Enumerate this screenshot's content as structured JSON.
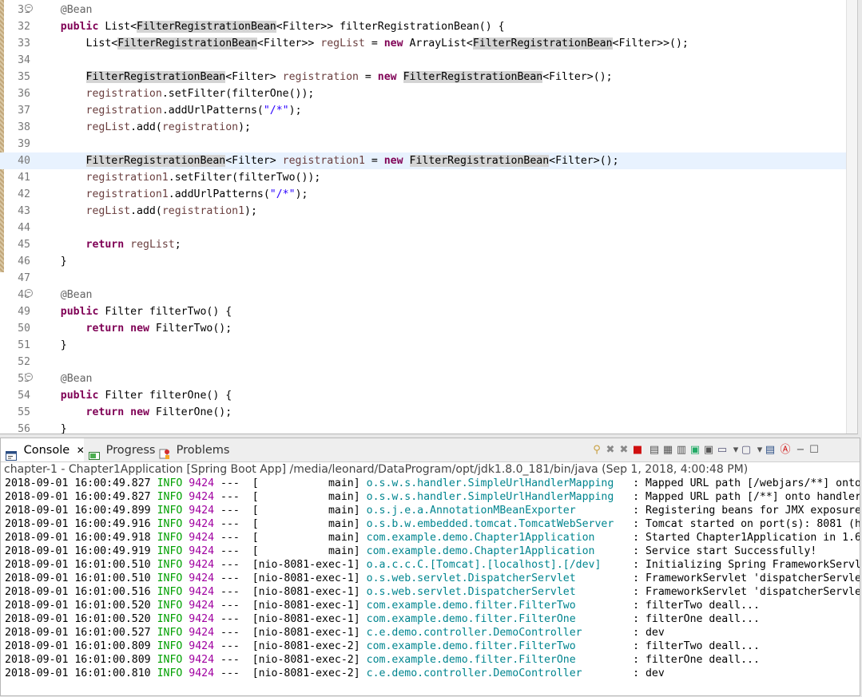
{
  "editor": {
    "lines": [
      {
        "n": "31",
        "fold": true,
        "segs": [
          {
            "t": "    "
          },
          {
            "t": "@Bean",
            "c": "ann"
          }
        ]
      },
      {
        "n": "32",
        "segs": [
          {
            "t": "    "
          },
          {
            "t": "public",
            "c": "kw"
          },
          {
            "t": " List<"
          },
          {
            "t": "FilterRegistrationBean",
            "c": "hl"
          },
          {
            "t": "<Filter>> filterRegistrationBean() {"
          }
        ]
      },
      {
        "n": "33",
        "segs": [
          {
            "t": "        List<"
          },
          {
            "t": "FilterRegistrationBean",
            "c": "hl"
          },
          {
            "t": "<Filter>> "
          },
          {
            "t": "regList",
            "c": "fld"
          },
          {
            "t": " = "
          },
          {
            "t": "new",
            "c": "kw"
          },
          {
            "t": " ArrayList<"
          },
          {
            "t": "FilterRegistrationBean",
            "c": "hl"
          },
          {
            "t": "<Filter>>();"
          }
        ]
      },
      {
        "n": "34",
        "segs": []
      },
      {
        "n": "35",
        "segs": [
          {
            "t": "        "
          },
          {
            "t": "FilterRegistrationBean",
            "c": "hl"
          },
          {
            "t": "<Filter> "
          },
          {
            "t": "registration",
            "c": "fld"
          },
          {
            "t": " = "
          },
          {
            "t": "new",
            "c": "kw"
          },
          {
            "t": " "
          },
          {
            "t": "FilterRegistrationBean",
            "c": "hl"
          },
          {
            "t": "<Filter>();"
          }
        ]
      },
      {
        "n": "36",
        "segs": [
          {
            "t": "        "
          },
          {
            "t": "registration",
            "c": "fld"
          },
          {
            "t": ".setFilter(filterOne());"
          }
        ]
      },
      {
        "n": "37",
        "segs": [
          {
            "t": "        "
          },
          {
            "t": "registration",
            "c": "fld"
          },
          {
            "t": ".addUrlPatterns("
          },
          {
            "t": "\"/*\"",
            "c": "str"
          },
          {
            "t": ");"
          }
        ]
      },
      {
        "n": "38",
        "segs": [
          {
            "t": "        "
          },
          {
            "t": "regList",
            "c": "fld"
          },
          {
            "t": ".add("
          },
          {
            "t": "registration",
            "c": "fld"
          },
          {
            "t": ");"
          }
        ]
      },
      {
        "n": "39",
        "segs": []
      },
      {
        "n": "40",
        "current": true,
        "segs": [
          {
            "t": "        "
          },
          {
            "t": "FilterRegistrationBean",
            "c": "hl"
          },
          {
            "t": "<Filter> "
          },
          {
            "t": "registration1",
            "c": "fld"
          },
          {
            "t": " = "
          },
          {
            "t": "new",
            "c": "kw"
          },
          {
            "t": " "
          },
          {
            "t": "FilterRegistrationBean",
            "c": "hl"
          },
          {
            "t": "<Filter>();"
          }
        ]
      },
      {
        "n": "41",
        "segs": [
          {
            "t": "        "
          },
          {
            "t": "registration1",
            "c": "fld"
          },
          {
            "t": ".setFilter(filterTwo());"
          }
        ]
      },
      {
        "n": "42",
        "segs": [
          {
            "t": "        "
          },
          {
            "t": "registration1",
            "c": "fld"
          },
          {
            "t": ".addUrlPatterns("
          },
          {
            "t": "\"/*\"",
            "c": "str"
          },
          {
            "t": ");"
          }
        ]
      },
      {
        "n": "43",
        "segs": [
          {
            "t": "        "
          },
          {
            "t": "regList",
            "c": "fld"
          },
          {
            "t": ".add("
          },
          {
            "t": "registration1",
            "c": "fld"
          },
          {
            "t": ");"
          }
        ]
      },
      {
        "n": "44",
        "segs": []
      },
      {
        "n": "45",
        "segs": [
          {
            "t": "        "
          },
          {
            "t": "return",
            "c": "kw"
          },
          {
            "t": " "
          },
          {
            "t": "regList",
            "c": "fld"
          },
          {
            "t": ";"
          }
        ]
      },
      {
        "n": "46",
        "segs": [
          {
            "t": "    }"
          }
        ]
      },
      {
        "n": "47",
        "segs": []
      },
      {
        "n": "48",
        "fold": true,
        "segs": [
          {
            "t": "    "
          },
          {
            "t": "@Bean",
            "c": "ann"
          }
        ]
      },
      {
        "n": "49",
        "segs": [
          {
            "t": "    "
          },
          {
            "t": "public",
            "c": "kw"
          },
          {
            "t": " Filter filterTwo() {"
          }
        ]
      },
      {
        "n": "50",
        "segs": [
          {
            "t": "        "
          },
          {
            "t": "return",
            "c": "kw"
          },
          {
            "t": " "
          },
          {
            "t": "new",
            "c": "kw"
          },
          {
            "t": " FilterTwo();"
          }
        ]
      },
      {
        "n": "51",
        "segs": [
          {
            "t": "    }"
          }
        ]
      },
      {
        "n": "52",
        "segs": []
      },
      {
        "n": "53",
        "fold": true,
        "segs": [
          {
            "t": "    "
          },
          {
            "t": "@Bean",
            "c": "ann"
          }
        ]
      },
      {
        "n": "54",
        "segs": [
          {
            "t": "    "
          },
          {
            "t": "public",
            "c": "kw"
          },
          {
            "t": " Filter filterOne() {"
          }
        ]
      },
      {
        "n": "55",
        "segs": [
          {
            "t": "        "
          },
          {
            "t": "return",
            "c": "kw"
          },
          {
            "t": " "
          },
          {
            "t": "new",
            "c": "kw"
          },
          {
            "t": " FilterOne();"
          }
        ]
      },
      {
        "n": "56",
        "segs": [
          {
            "t": "    }"
          }
        ]
      }
    ]
  },
  "console": {
    "tabs": {
      "console": {
        "label": "Console",
        "icon": "console-icon",
        "close": "✕"
      },
      "progress": {
        "label": "Progress",
        "icon": "progress-icon"
      },
      "problems": {
        "label": "Problems",
        "icon": "problems-icon"
      }
    },
    "toolbar_icons": [
      "pin-icon",
      "remove-launch-icon",
      "remove-all-terminated-icon",
      "terminate-icon",
      "clear-console-icon",
      "scroll-lock-icon",
      "word-wrap-icon",
      "show-on-stdout-icon",
      "show-on-stderr-icon",
      "open-console-icon",
      "open-console-menu-icon",
      "display-console-icon",
      "display-console-menu-icon",
      "debug-icon",
      "spring-boot-icon",
      "minimize-icon",
      "maximize-icon"
    ],
    "process_label": "chapter-1 - Chapter1Application [Spring Boot App] /media/leonard/DataProgram/opt/jdk1.8.0_181/bin/java (Sep 1, 2018, 4:00:48 PM)",
    "log": [
      {
        "ts": "2018-09-01 16:00:49.827",
        "level": "INFO",
        "pid": "9424",
        "thread": "---  [           main]",
        "logger": "o.s.w.s.handler.SimpleUrlHandlerMapping ",
        "msg": "  : Mapped URL path [/webjars/**] onto"
      },
      {
        "ts": "2018-09-01 16:00:49.827",
        "level": "INFO",
        "pid": "9424",
        "thread": "---  [           main]",
        "logger": "o.s.w.s.handler.SimpleUrlHandlerMapping ",
        "msg": "  : Mapped URL path [/**] onto handler"
      },
      {
        "ts": "2018-09-01 16:00:49.899",
        "level": "INFO",
        "pid": "9424",
        "thread": "---  [           main]",
        "logger": "o.s.j.e.a.AnnotationMBeanExporter       ",
        "msg": "  : Registering beans for JMX exposure"
      },
      {
        "ts": "2018-09-01 16:00:49.916",
        "level": "INFO",
        "pid": "9424",
        "thread": "---  [           main]",
        "logger": "o.s.b.w.embedded.tomcat.TomcatWebServer ",
        "msg": "  : Tomcat started on port(s): 8081 (h"
      },
      {
        "ts": "2018-09-01 16:00:49.918",
        "level": "INFO",
        "pid": "9424",
        "thread": "---  [           main]",
        "logger": "com.example.demo.Chapter1Application    ",
        "msg": "  : Started Chapter1Application in 1.6"
      },
      {
        "ts": "2018-09-01 16:00:49.919",
        "level": "INFO",
        "pid": "9424",
        "thread": "---  [           main]",
        "logger": "com.example.demo.Chapter1Application    ",
        "msg": "  : Service start Successfully!"
      },
      {
        "ts": "2018-09-01 16:01:00.510",
        "level": "INFO",
        "pid": "9424",
        "thread": "---  [nio-8081-exec-1]",
        "logger": "o.a.c.c.C.[Tomcat].[localhost].[/dev]   ",
        "msg": "  : Initializing Spring FrameworkServl"
      },
      {
        "ts": "2018-09-01 16:01:00.510",
        "level": "INFO",
        "pid": "9424",
        "thread": "---  [nio-8081-exec-1]",
        "logger": "o.s.web.servlet.DispatcherServlet       ",
        "msg": "  : FrameworkServlet 'dispatcherServle"
      },
      {
        "ts": "2018-09-01 16:01:00.516",
        "level": "INFO",
        "pid": "9424",
        "thread": "---  [nio-8081-exec-1]",
        "logger": "o.s.web.servlet.DispatcherServlet       ",
        "msg": "  : FrameworkServlet 'dispatcherServle"
      },
      {
        "ts": "2018-09-01 16:01:00.520",
        "level": "INFO",
        "pid": "9424",
        "thread": "---  [nio-8081-exec-1]",
        "logger": "com.example.demo.filter.FilterTwo       ",
        "msg": "  : filterTwo deall..."
      },
      {
        "ts": "2018-09-01 16:01:00.520",
        "level": "INFO",
        "pid": "9424",
        "thread": "---  [nio-8081-exec-1]",
        "logger": "com.example.demo.filter.FilterOne       ",
        "msg": "  : filterOne deall..."
      },
      {
        "ts": "2018-09-01 16:01:00.527",
        "level": "INFO",
        "pid": "9424",
        "thread": "---  [nio-8081-exec-1]",
        "logger": "c.e.demo.controller.DemoController      ",
        "msg": "  : dev"
      },
      {
        "ts": "2018-09-01 16:01:00.809",
        "level": "INFO",
        "pid": "9424",
        "thread": "---  [nio-8081-exec-2]",
        "logger": "com.example.demo.filter.FilterTwo       ",
        "msg": "  : filterTwo deall..."
      },
      {
        "ts": "2018-09-01 16:01:00.809",
        "level": "INFO",
        "pid": "9424",
        "thread": "---  [nio-8081-exec-2]",
        "logger": "com.example.demo.filter.FilterOne       ",
        "msg": "  : filterOne deall..."
      },
      {
        "ts": "2018-09-01 16:01:00.810",
        "level": "INFO",
        "pid": "9424",
        "thread": "---  [nio-8081-exec-2]",
        "logger": "c.e.demo.controller.DemoController      ",
        "msg": "  : dev"
      }
    ]
  },
  "colors": {
    "keyword": "#7f0055",
    "annotation": "#646464",
    "field": "#6a3e3e",
    "string": "#2a00ff",
    "occurrence_highlight": "#d4d4d4",
    "current_line": "#e8f2fe",
    "log_level": "#00a000",
    "log_pid": "#a000a0",
    "log_logger": "#00858f",
    "terminate": "#d01010"
  }
}
